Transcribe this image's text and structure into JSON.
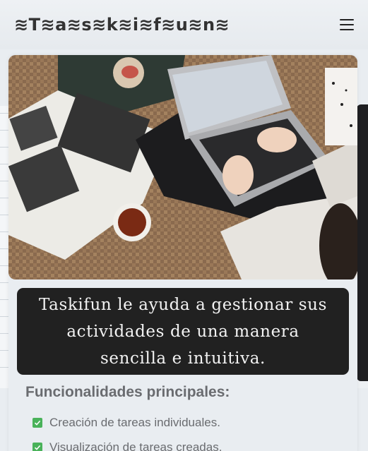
{
  "navbar": {
    "brand": "≋T≋a≋s≋k≋i≋f≋u≋n≋",
    "menu_icon": "hamburger-menu-icon"
  },
  "hero": {
    "image_alt": "hero-image"
  },
  "banner": {
    "text": "Taskifun le ayuda a gestionar sus actividades de una manera sencilla e intuitiva."
  },
  "features": {
    "title": "Funcionalidades principales:",
    "items": [
      {
        "label": "Creación de tareas individuales.",
        "icon": "checkbox-checked-icon"
      },
      {
        "label": "Visualización de tareas creadas.",
        "icon": "checkbox-checked-icon"
      }
    ]
  },
  "colors": {
    "check_green": "#49b25a",
    "banner_bg": "#212121",
    "page_bg": "#e9edf1"
  }
}
